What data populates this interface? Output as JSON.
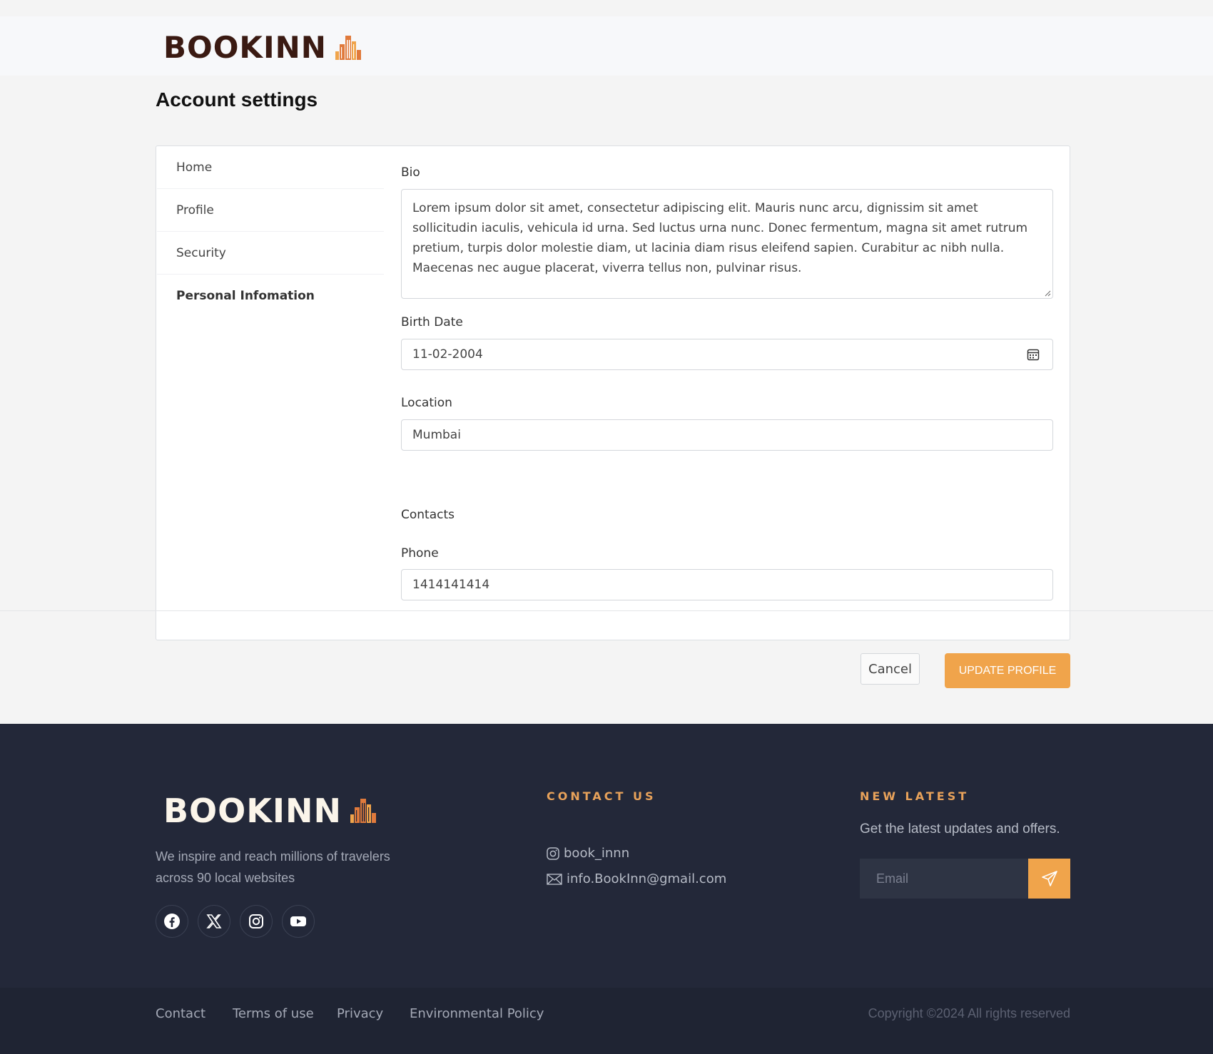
{
  "brand": {
    "name": "BOOKINN",
    "accent": "#f0a44b",
    "dark": "#3a1a12"
  },
  "page": {
    "title": "Account settings"
  },
  "sidebar": {
    "items": [
      {
        "label": "Home"
      },
      {
        "label": "Profile"
      },
      {
        "label": "Security"
      },
      {
        "label": "Personal Infomation",
        "active": true
      }
    ]
  },
  "form": {
    "bio_label": "Bio",
    "bio_value": "Lorem ipsum dolor sit amet, consectetur adipiscing elit. Mauris nunc arcu, dignissim sit amet sollicitudin iaculis, vehicula id urna. Sed luctus urna nunc. Donec fermentum, magna sit amet rutrum pretium, turpis dolor molestie diam, ut lacinia diam risus eleifend sapien. Curabitur ac nibh nulla. Maecenas nec augue placerat, viverra tellus non, pulvinar risus.",
    "birth_label": "Birth Date",
    "birth_value": "11-02-2004",
    "location_label": "Location",
    "location_value": "Mumbai",
    "contacts_heading": "Contacts",
    "phone_label": "Phone",
    "phone_value": "1414141414"
  },
  "actions": {
    "cancel": "Cancel",
    "update": "UPDATE PROFILE"
  },
  "footer": {
    "tagline": "We inspire and reach millions of travelers across 90 local websites",
    "social_icons": [
      "facebook-icon",
      "x-icon",
      "instagram-icon",
      "youtube-icon"
    ],
    "contact_heading": "CONTACT US",
    "instagram": "book_innn",
    "email": "info.BookInn@gmail.com",
    "news_heading": "NEW LATEST",
    "news_text": "Get the latest updates and offers.",
    "email_placeholder": "Email",
    "links": [
      "Contact",
      "Terms of use",
      "Privacy",
      "Environmental Policy"
    ],
    "copyright": "Copyright ©2024 All rights reserved"
  }
}
